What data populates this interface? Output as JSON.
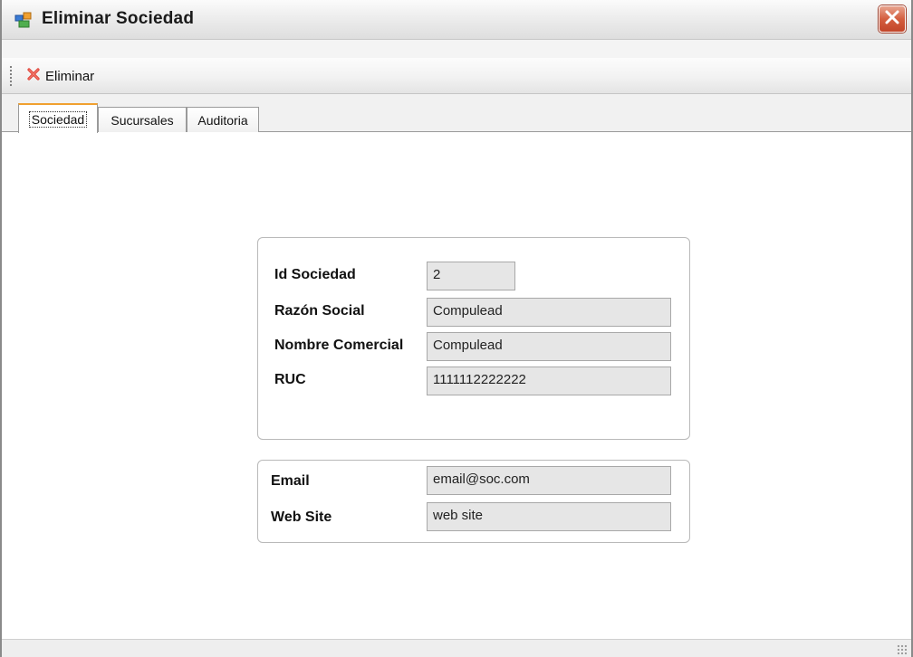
{
  "window": {
    "title": "Eliminar Sociedad",
    "icon": "window-app-icon",
    "close_icon": "close-icon"
  },
  "toolbar": {
    "delete_label": "Eliminar",
    "delete_icon": "delete-x-icon"
  },
  "tabs": [
    {
      "label": "Sociedad",
      "active": true
    },
    {
      "label": "Sucursales",
      "active": false
    },
    {
      "label": "Auditoria",
      "active": false
    }
  ],
  "sociedad": {
    "id_label": "Id Sociedad",
    "id_value": "2",
    "razon_label": "Razón Social",
    "razon_value": "Compulead",
    "nombre_label": "Nombre Comercial",
    "nombre_value": "Compulead",
    "ruc_label": "RUC",
    "ruc_value": "1111112222222"
  },
  "contacto": {
    "email_label": "Email",
    "email_value": "email@soc.com",
    "web_label": "Web Site",
    "web_value": "web site"
  },
  "colors": {
    "close_button": "#d45f3f",
    "field_bg": "#e6e6e6",
    "active_tab_accent": "#f0a030",
    "delete_icon": "#e0443a"
  }
}
